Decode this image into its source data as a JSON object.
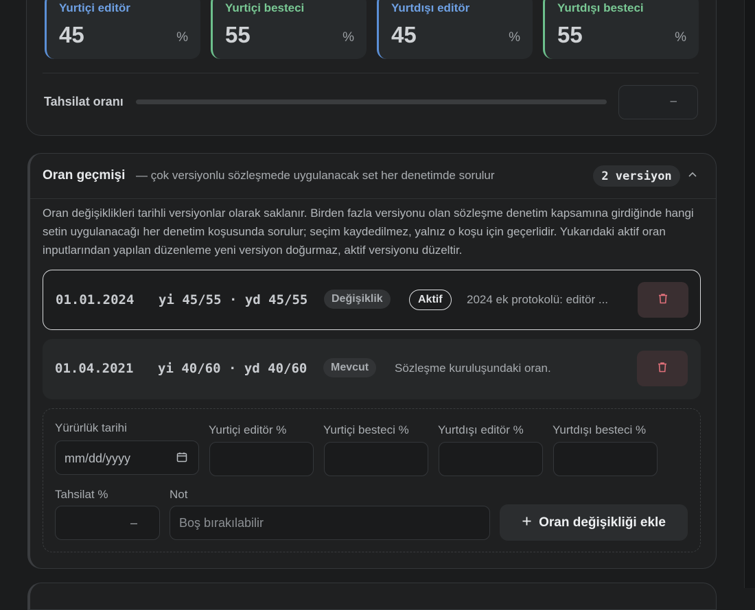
{
  "ratios": [
    {
      "label": "Yurtiçi editör",
      "value": "45",
      "unit": "%"
    },
    {
      "label": "Yurtiçi besteci",
      "value": "55",
      "unit": "%"
    },
    {
      "label": "Yurtdışı editör",
      "value": "45",
      "unit": "%"
    },
    {
      "label": "Yurtdışı besteci",
      "value": "55",
      "unit": "%"
    }
  ],
  "tahsilat": {
    "label": "Tahsilat oranı",
    "value": "–"
  },
  "history": {
    "title": "Oran geçmişi",
    "subtitle": "— çok versiyonlu sözleşmede uygulanacak set her denetimde sorulur",
    "version_badge": "2 versiyon",
    "description": "Oran değişiklikleri tarihli versiyonlar olarak saklanır. Birden fazla versiyonu olan sözleşme denetim kapsamına girdiğinde hangi setin uygulanacağı her denetim koşusunda sorulur; seçim kaydedilmez, yalnız o koşu için geçerlidir. Yukarıdaki aktif oran inputlarından yapılan düzenleme yeni versiyon doğurmaz, aktif versiyonu düzeltir.",
    "versions": [
      {
        "date": "01.01.2024",
        "ratios": "yi 45/55 · yd 45/55",
        "tag": "Değişiklik",
        "status": "Aktif",
        "note": "2024 ek protokolü: editör ..."
      },
      {
        "date": "01.04.2021",
        "ratios": "yi 40/60 · yd 40/60",
        "tag": "Mevcut",
        "status": "",
        "note": "Sözleşme kuruluşundaki oran."
      }
    ]
  },
  "form": {
    "date_label": "Yürürlük tarihi",
    "date_placeholder": "mm/dd/yyyy",
    "yi_editor_label": "Yurtiçi editör %",
    "yi_besteci_label": "Yurtiçi besteci %",
    "yd_editor_label": "Yurtdışı editör %",
    "yd_besteci_label": "Yurtdışı besteci %",
    "tahsilat_label": "Tahsilat %",
    "tahsilat_value": "–",
    "note_label": "Not",
    "note_placeholder": "Boş bırakılabilir",
    "add_button": "Oran değişikliği ekle"
  },
  "colors": {
    "accent_blue": "#5b8fd6",
    "accent_green": "#6cbf8c",
    "delete_red": "#e0707a"
  }
}
